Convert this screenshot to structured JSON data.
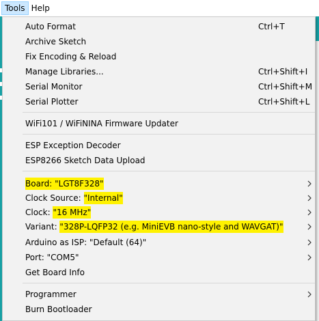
{
  "menubar": {
    "items": [
      {
        "label": "Tools"
      },
      {
        "label": "Help"
      }
    ]
  },
  "tools_menu": {
    "auto_format": {
      "label": "Auto Format",
      "shortcut": "Ctrl+T"
    },
    "archive_sketch": {
      "label": "Archive Sketch"
    },
    "fix_encoding": {
      "label": "Fix Encoding & Reload"
    },
    "manage_libraries": {
      "label": "Manage Libraries...",
      "shortcut": "Ctrl+Shift+I"
    },
    "serial_monitor": {
      "label": "Serial Monitor",
      "shortcut": "Ctrl+Shift+M"
    },
    "serial_plotter": {
      "label": "Serial Plotter",
      "shortcut": "Ctrl+Shift+L"
    },
    "wifi_updater": {
      "label": "WiFi101 / WiFiNINA Firmware Updater"
    },
    "esp_exception": {
      "label": "ESP Exception Decoder"
    },
    "esp_upload": {
      "label": "ESP8266 Sketch Data Upload"
    },
    "board": {
      "label": "Board: \"LGT8F328\""
    },
    "clock_source": {
      "prefix": "Clock Source: ",
      "value": "\"Internal\""
    },
    "clock": {
      "prefix": "Clock: ",
      "value": "\"16 MHz\""
    },
    "variant": {
      "prefix": "Variant: ",
      "value": "\"328P-LQFP32 (e.g. MiniEVB nano-style and WAVGAT)\""
    },
    "arduino_isp": {
      "label": "Arduino as ISP: \"Default (64)\""
    },
    "port": {
      "label": "Port: \"COM5\""
    },
    "board_info": {
      "label": "Get Board Info"
    },
    "programmer": {
      "label": "Programmer"
    },
    "burn_bootloader": {
      "label": "Burn Bootloader"
    }
  },
  "colors": {
    "highlight": "#fff200",
    "menu_background": "#f2f2f2",
    "active_menubar": "#cce8ff",
    "window_accent": "#17a1a5"
  }
}
